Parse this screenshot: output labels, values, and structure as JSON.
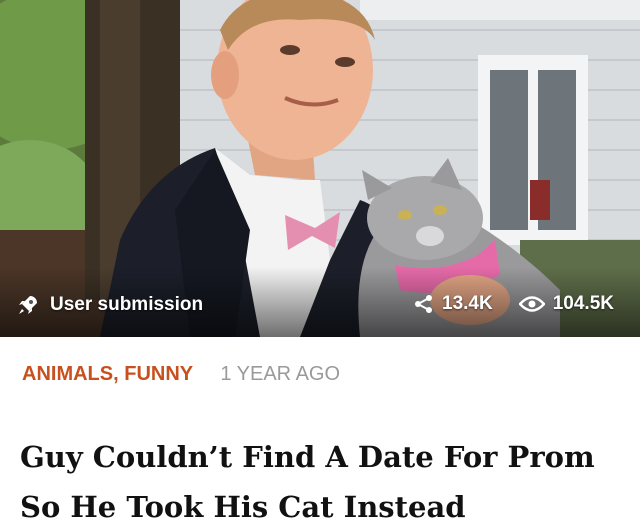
{
  "post": {
    "badge_label": "User submission",
    "shares": "13.4K",
    "views": "104.5K",
    "categories": [
      "ANIMALS",
      "FUNNY"
    ],
    "category_separator": ",",
    "time_ago": "1 YEAR AGO",
    "title": "Guy Couldn’t Find A Date For Prom So He Took His Cat Instead"
  },
  "icons": {
    "badge": "rocket-icon",
    "shares": "share-icon",
    "views": "eye-icon"
  },
  "colors": {
    "category": "#c8501e",
    "time": "#9a9a9a",
    "title": "#111111"
  }
}
